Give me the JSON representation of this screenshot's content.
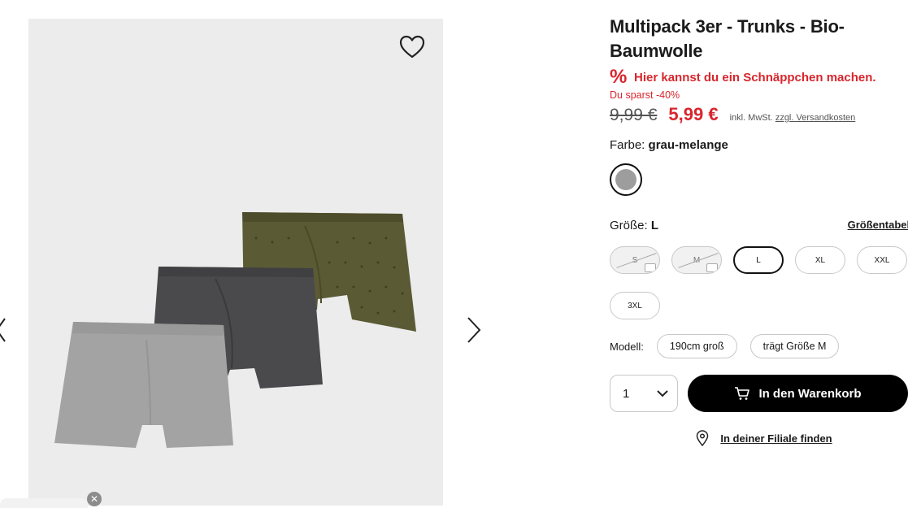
{
  "product": {
    "title": "Multipack 3er - Trunks - Bio-Baumwolle",
    "deal_symbol": "%",
    "deal_text": "Hier kannst du ein Schnäppchen machen.",
    "savings": "Du sparst -40%",
    "old_price": "9,99 €",
    "new_price": "5,99 €",
    "tax_text": "inkl. MwSt.",
    "shipping_link": "zzgl. Versandkosten",
    "color_label": "Farbe:",
    "color_value": "grau-melange",
    "size_label": "Größe:",
    "size_value": "L",
    "size_table_link": "Größentabelle",
    "sizes": [
      {
        "label": "S",
        "state": "unavailable"
      },
      {
        "label": "M",
        "state": "unavailable"
      },
      {
        "label": "L",
        "state": "selected"
      },
      {
        "label": "XL",
        "state": "available"
      },
      {
        "label": "XXL",
        "state": "available"
      },
      {
        "label": "3XL",
        "state": "available"
      }
    ],
    "model_label": "Modell:",
    "model_height": "190cm groß",
    "model_size": "trägt Größe M",
    "quantity": "1",
    "add_to_cart": "In den Warenkorb",
    "find_store": "In deiner Filiale finden"
  },
  "colors": {
    "accent_red": "#d8262d",
    "cart_button": "#000000",
    "gallery_bg": "#ececec"
  },
  "icons": {
    "wishlist": "heart-outline-icon",
    "next": "chevron-right-icon",
    "prev": "chevron-left-icon",
    "cart": "cart-icon",
    "location": "location-pin-icon",
    "dropdown": "chevron-down-icon"
  }
}
